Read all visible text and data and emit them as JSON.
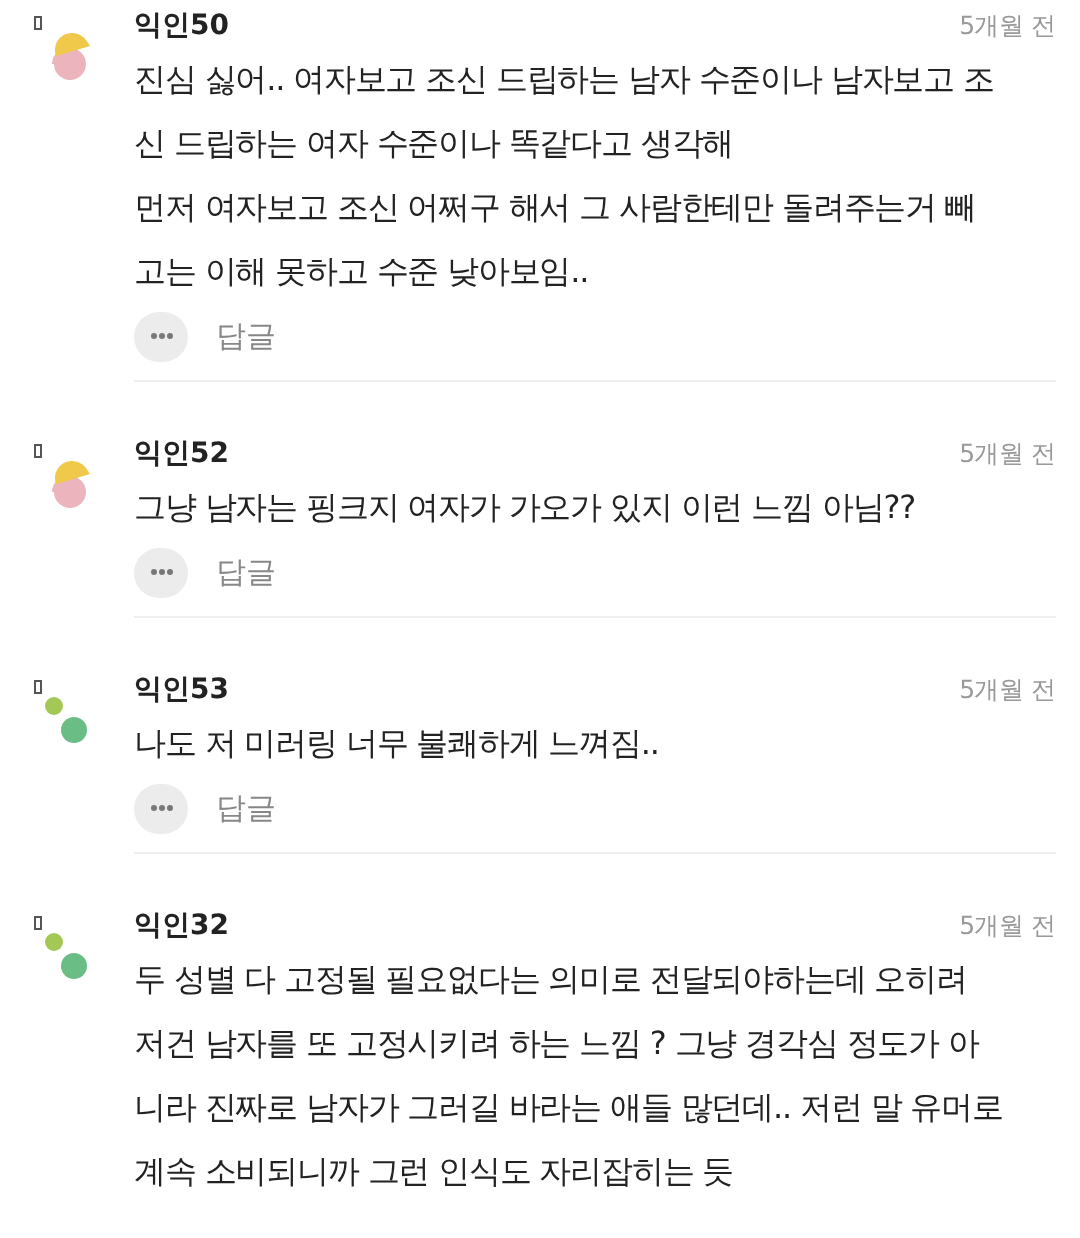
{
  "comments": [
    {
      "author": "익인50",
      "time": "5개월 전",
      "kind": "moon",
      "lines": [
        "진심 싫어.. 여자보고 조신 드립하는 남자 수준이나 남자보고 조",
        "신 드립하는 여자 수준이나 똑같다고 생각해",
        "먼저 여자보고 조신 어쩌구 해서 그 사람한테만 돌려주는거 빼",
        "고는 이해 못하고 수준 낮아보임.."
      ],
      "reply": "답글"
    },
    {
      "author": "익인52",
      "time": "5개월 전",
      "kind": "moon",
      "lines": [
        "그냥 남자는 핑크지 여자가 가오가 있지 이런 느낌 아님??"
      ],
      "reply": "답글"
    },
    {
      "author": "익인53",
      "time": "5개월 전",
      "kind": "dots",
      "lines": [
        "나도 저 미러링 너무 불쾌하게 느껴짐.."
      ],
      "reply": "답글"
    },
    {
      "author": "익인32",
      "time": "5개월 전",
      "kind": "dots",
      "lines": [
        "두 성별 다 고정될 필요없다는 의미로 전달되야하는데 오히려",
        "저건 남자를 또 고정시키려 하는 느낌 ? 그냥 경각심 정도가 아",
        "니라 진짜로 남자가 그러길 바라는 애들 많던데.. 저런 말 유머로",
        "계속 소비되니까 그런 인식도 자리잡히는 듯"
      ]
    }
  ]
}
